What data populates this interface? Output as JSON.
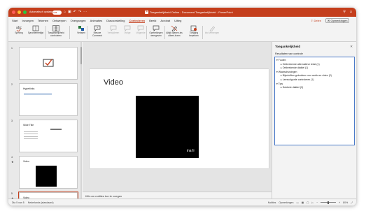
{
  "titlebar": {
    "autosave_label": "Automatisch opslaan",
    "autosave_state": "UIT",
    "document_title": "Toegankelijkheid Online - Document Toegankelijkheid - PowerPoint"
  },
  "menu": {
    "items": [
      "Start",
      "Invoegen",
      "Tekenen",
      "Ontwerpen",
      "Overgangen",
      "Animaties",
      "Diavoorstelling",
      "Controleren",
      "Beeld",
      "Acrobat",
      "Uitleg"
    ],
    "active_index": 7,
    "share_label": "Delen",
    "comments_label": "Opmerkingen"
  },
  "ribbon": {
    "buttons": [
      {
        "label": "Spelling",
        "icon": "spelling-icon",
        "enabled": true
      },
      {
        "label": "Synoniemenlijst",
        "icon": "thesaurus-icon",
        "enabled": true
      },
      {
        "label": "Toegankelijkheid controleren",
        "icon": "accessibility-check-icon",
        "enabled": true
      },
      {
        "label": "Vertalen",
        "icon": "translate-icon",
        "enabled": true
      },
      {
        "label": "Nieuwe Comment",
        "icon": "new-comment-icon",
        "enabled": true
      },
      {
        "label": "Verwijderen",
        "icon": "delete-comment-icon",
        "enabled": false
      },
      {
        "label": "Vorige",
        "icon": "previous-comment-icon",
        "enabled": false
      },
      {
        "label": "Volgende",
        "icon": "next-comment-icon",
        "enabled": false
      },
      {
        "label": "Opmerkingen weergeven",
        "icon": "show-comments-icon",
        "enabled": true
      },
      {
        "label": "Altijd openen als alleen-lezen",
        "icon": "read-only-icon",
        "enabled": true
      },
      {
        "label": "Toegang beperken",
        "icon": "restrict-access-icon",
        "enabled": true
      },
      {
        "label": "Inkt verbergen",
        "icon": "hide-ink-icon",
        "enabled": false
      }
    ]
  },
  "slides": [
    {
      "number": "1",
      "title": "",
      "star": false
    },
    {
      "number": "2",
      "title": "Hyperlinks",
      "star": false
    },
    {
      "number": "3",
      "title": "Slide Title",
      "star": false
    },
    {
      "number": "4",
      "title": "Video",
      "star": true
    },
    {
      "number": "5",
      "title": "Video",
      "star": true
    }
  ],
  "editor": {
    "slide_title": "Video",
    "video_watermark": "ina fr",
    "notes_placeholder": "Klik om notities toe te voegen"
  },
  "accessibility": {
    "pane_title": "Toegankelijkheid",
    "results_heading": "Resultaten van controle",
    "tree": [
      {
        "level": 0,
        "text": "Fouten"
      },
      {
        "level": 1,
        "text": "Ontbrekende alternatieve tekst (1)"
      },
      {
        "level": 1,
        "text": "Ontbrekende diatitel (1)"
      },
      {
        "level": 0,
        "text": "Waarschuwingen"
      },
      {
        "level": 1,
        "text": "Bijschriften gebruiken voor audio en video (2)"
      },
      {
        "level": 1,
        "text": "Leesvolgorde controleren (1)"
      },
      {
        "level": 0,
        "text": "Tips"
      },
      {
        "level": 1,
        "text": "Dubbele diatitel (3)"
      }
    ]
  },
  "status": {
    "slide_count": "Dia 5 van 5",
    "language": "Nederlands (standaard)",
    "notes_label": "Notities",
    "comments_label": "Opmerkingen",
    "zoom": "80%"
  },
  "colors": {
    "accent": "#c43e1c",
    "focus": "#4a7ac9"
  }
}
